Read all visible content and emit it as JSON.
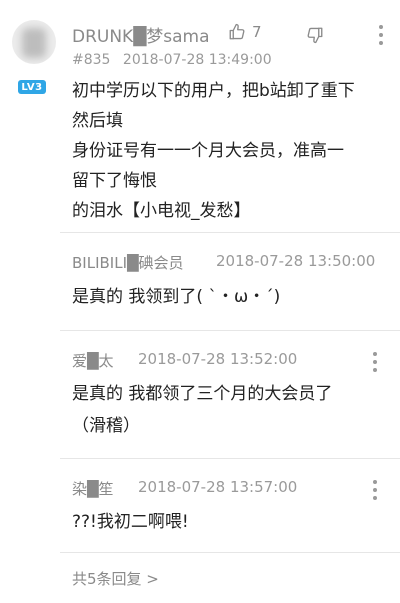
{
  "comment": {
    "username": "DRUNK█梦sama",
    "level_badge": "LV3",
    "like_count": "7",
    "floor": "#835",
    "timestamp": "2018-07-28 13:49:00",
    "text": "初中学历以下的用户，把b站卸了重下\n然后填\n身份证号有一一个月大会员，准高一\n留下了悔恨\n的泪水【小电视_发愁】"
  },
  "replies": [
    {
      "username": "BILIBILI█碘会员",
      "timestamp": "2018-07-28 13:50:00",
      "text": "是真的 我领到了( `・ω・´)"
    },
    {
      "username": "爱█太",
      "timestamp": "2018-07-28 13:52:00",
      "text": "是真的 我都领了三个月的大会员了\n（滑稽）"
    },
    {
      "username": "染█笙",
      "timestamp": "2018-07-28 13:57:00",
      "text": "??!我初二啊喂!"
    }
  ],
  "more_replies": "共5条回复 >",
  "colors": {
    "level_badge": "#2fa6e6",
    "muted_text": "#8a8a8a",
    "divider": "#e6e6e6"
  },
  "icons": [
    "thumbs-up-icon",
    "thumbs-down-icon",
    "more-vertical-icon"
  ]
}
